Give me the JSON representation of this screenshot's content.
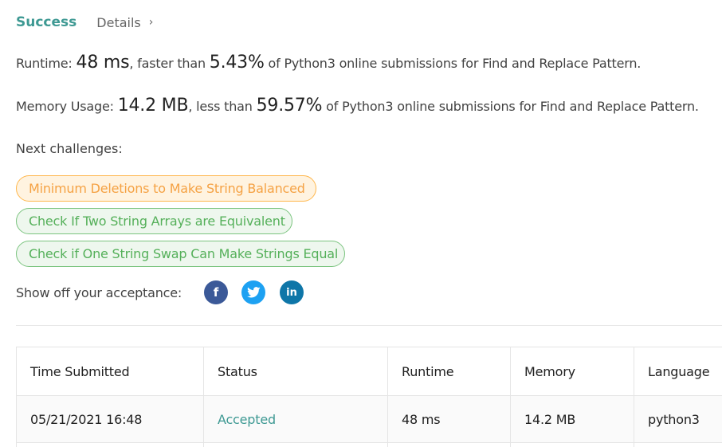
{
  "header": {
    "success_tab": "Success",
    "details_tab": "Details"
  },
  "runtime": {
    "label": "Runtime: ",
    "value": "48 ms",
    "middle": ", faster than ",
    "percent": "5.43%",
    "suffix": " of Python3 online submissions for Find and Replace Pattern."
  },
  "memory": {
    "label": "Memory Usage: ",
    "value": "14.2 MB",
    "middle": ", less than ",
    "percent": "59.57%",
    "suffix": " of Python3 online submissions for Find and Replace Pattern."
  },
  "next_challenges": {
    "title": "Next challenges:",
    "items": [
      {
        "label": "Minimum Deletions to Make String Balanced",
        "difficulty": "medium"
      },
      {
        "label": "Check If Two String Arrays are Equivalent",
        "difficulty": "easy"
      },
      {
        "label": "Check if One String Swap Can Make Strings Equal",
        "difficulty": "easy"
      }
    ]
  },
  "share": {
    "label": "Show off your acceptance:",
    "icons": [
      "facebook-icon",
      "twitter-icon",
      "linkedin-icon"
    ]
  },
  "submissions": {
    "headers": [
      "Time Submitted",
      "Status",
      "Runtime",
      "Memory",
      "Language"
    ],
    "rows": [
      {
        "time": "05/21/2021 16:48",
        "status": "Accepted",
        "runtime": "48 ms",
        "memory": "14.2 MB",
        "language": "python3"
      }
    ]
  },
  "colors": {
    "accent": "#3e9993",
    "medium": "#ffb74d",
    "easy": "#7bc47f"
  }
}
